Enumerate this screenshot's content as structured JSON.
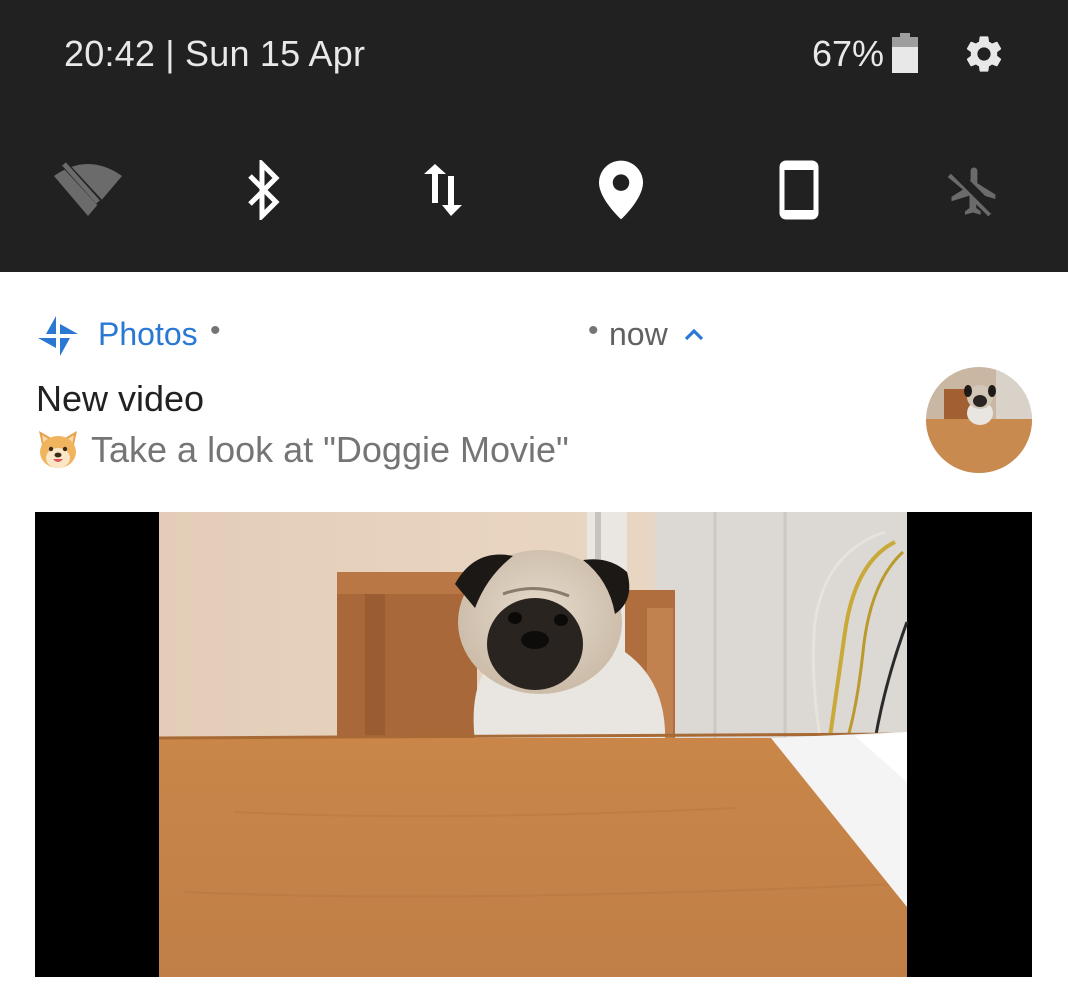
{
  "status": {
    "time_date": "20:42 | Sun 15 Apr",
    "battery_percent": "67%",
    "battery_level": 0.67
  },
  "quick_tiles": [
    {
      "name": "wifi",
      "icon": "wifi-off-icon",
      "state": "off"
    },
    {
      "name": "bluetooth",
      "icon": "bluetooth-icon",
      "state": "on"
    },
    {
      "name": "mobile-data",
      "icon": "mobile-data-icon",
      "state": "on"
    },
    {
      "name": "location",
      "icon": "location-pin-icon",
      "state": "on"
    },
    {
      "name": "auto-rotate",
      "icon": "phone-portrait-icon",
      "state": "on"
    },
    {
      "name": "airplane-mode",
      "icon": "airplane-mode-off-icon",
      "state": "off"
    }
  ],
  "notification": {
    "app_name": "Photos",
    "separator": "•",
    "time": "now",
    "title": "New video",
    "text": "Take a look at \"Doggie Movie\"",
    "emoji": "dog-face-emoji",
    "thumbnail": "pug-thumbnail",
    "media": "pug-at-table-video-frame"
  },
  "colors": {
    "panel_bg": "#212121",
    "icon_on": "#ffffff",
    "icon_off": "#6b6b6b",
    "accent": "#2a78d3",
    "secondary_text": "#757575"
  }
}
